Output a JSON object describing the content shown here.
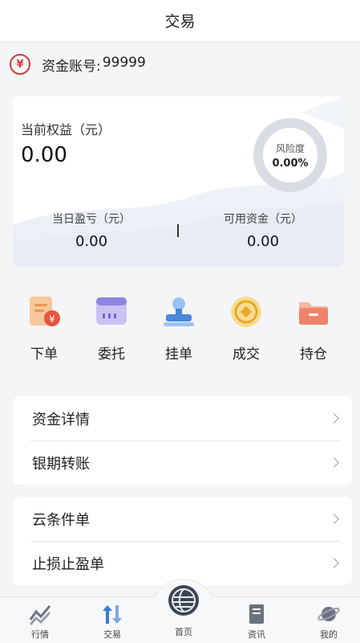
{
  "header": {
    "title": "交易"
  },
  "account": {
    "icon": "yen-badge-icon",
    "badge_char": "¥",
    "label": "资金账号:",
    "number": "99999"
  },
  "equity": {
    "label": "当前权益（元）",
    "value": "0.00",
    "risk_label": "风险度",
    "risk_value": "0.00%",
    "daily_pnl_label": "当日盈亏（元）",
    "daily_pnl_value": "0.00",
    "available_label": "可用资金（元）",
    "available_value": "0.00"
  },
  "shortcuts": [
    {
      "label": "下单",
      "icon": "order-icon"
    },
    {
      "label": "委托",
      "icon": "entrust-icon"
    },
    {
      "label": "挂单",
      "icon": "pending-order-icon"
    },
    {
      "label": "成交",
      "icon": "deal-coin-icon"
    },
    {
      "label": "持仓",
      "icon": "position-folder-icon"
    }
  ],
  "menu_group_1": [
    "资金详情",
    "银期转账"
  ],
  "menu_group_2": [
    "云条件单",
    "止损止盈单"
  ],
  "tabbar": [
    {
      "label": "行情",
      "icon": "market-chart-icon"
    },
    {
      "label": "交易",
      "icon": "trade-arrows-icon"
    },
    {
      "label": "首页",
      "icon": "home-globe-icon"
    },
    {
      "label": "资讯",
      "icon": "news-icon"
    },
    {
      "label": "我的",
      "icon": "planet-icon"
    }
  ],
  "colors": {
    "accent_red": "#d23a3a",
    "active_blue": "#3a7bd5",
    "tab_gray": "#6b7280"
  }
}
